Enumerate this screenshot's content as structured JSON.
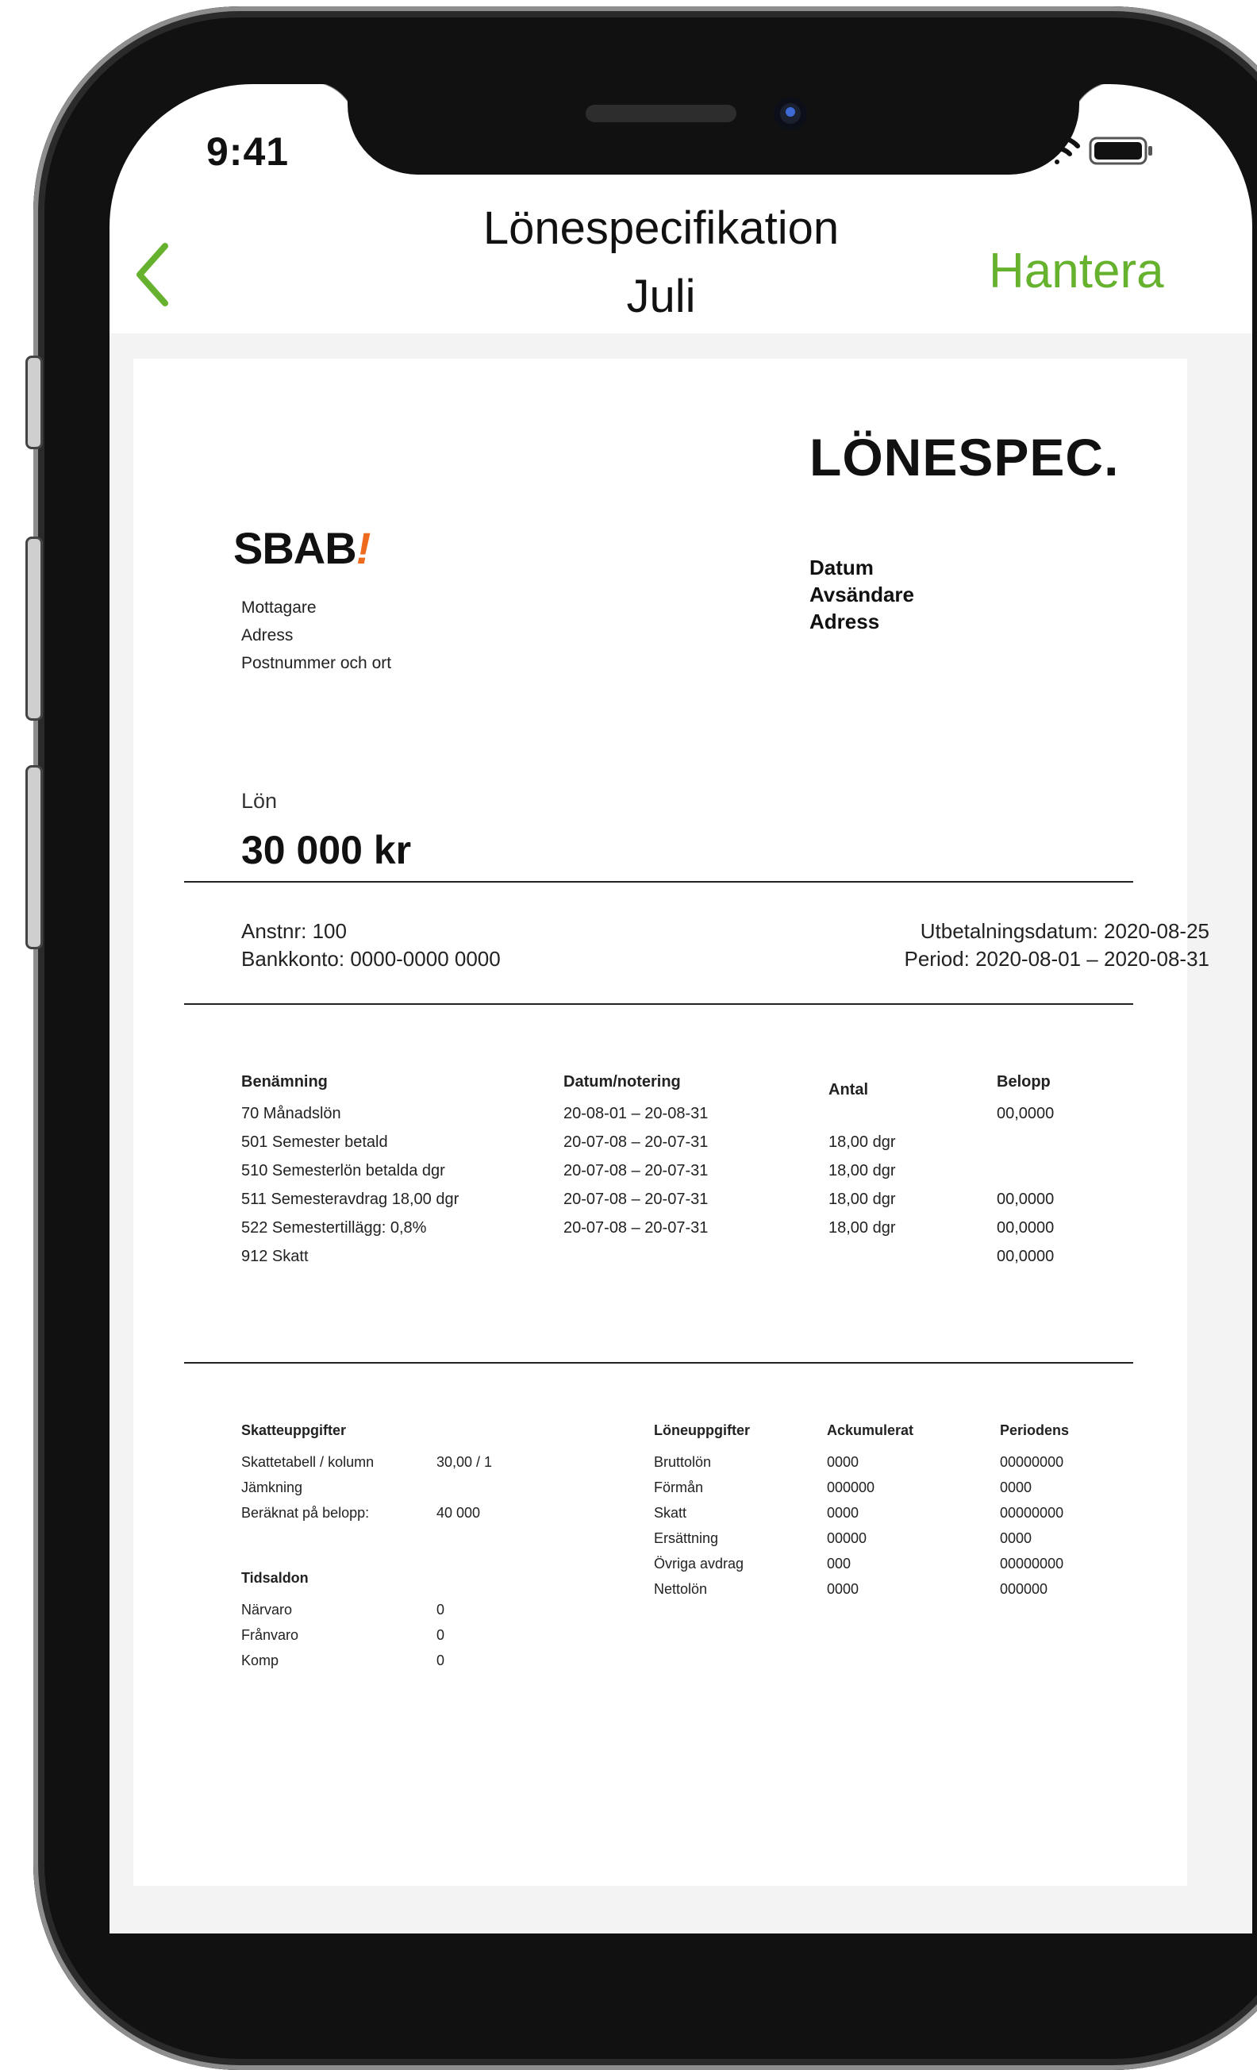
{
  "status_bar": {
    "time": "9:41"
  },
  "nav": {
    "title_line1": "Lönespecifikation",
    "title_line2": "Juli",
    "manage_label": "Hantera"
  },
  "document": {
    "heading": "LÖNESPEC.",
    "logo_text": "SBAB",
    "logo_mark": "!",
    "recipient": [
      "Mottagare",
      "Adress",
      "Postnummer och ort"
    ],
    "sender": [
      "Datum",
      "Avsändare",
      "Adress"
    ],
    "salary_label": "Lön",
    "salary_amount": "30 000 kr",
    "employee_number": "Anstnr: 100",
    "bank_account": "Bankkonto: 0000-0000 0000",
    "payout_date": "Utbetalningsdatum: 2020-08-25",
    "period": "Period: 2020-08-01 – 2020-08-31",
    "items": {
      "headers": [
        "Benämning",
        "Datum/notering",
        "Antal",
        "Belopp"
      ],
      "rows": [
        [
          "70 Månadslön",
          "20-08-01 – 20-08-31",
          "",
          "00,0000"
        ],
        [
          "501 Semester betald",
          "20-07-08 – 20-07-31",
          "18,00 dgr",
          ""
        ],
        [
          "510 Semesterlön betalda dgr",
          "20-07-08 – 20-07-31",
          "18,00 dgr",
          ""
        ],
        [
          "511 Semesteravdrag 18,00 dgr",
          "20-07-08 – 20-07-31",
          "18,00 dgr",
          "00,0000"
        ],
        [
          "522 Semestertillägg: 0,8%",
          "20-07-08 – 20-07-31",
          "18,00 dgr",
          "00,0000"
        ],
        [
          "912 Skatt",
          "",
          "",
          "00,0000"
        ]
      ]
    },
    "tax": {
      "title": "Skatteuppgifter",
      "rows": [
        [
          "Skattetabell / kolumn",
          "30,00 / 1"
        ],
        [
          "Jämkning",
          ""
        ],
        [
          "Beräknat på belopp:",
          "40 000"
        ]
      ]
    },
    "time_balance": {
      "title": "Tidsaldon",
      "rows": [
        [
          "Närvaro",
          "0"
        ],
        [
          "Frånvaro",
          "0"
        ],
        [
          "Komp",
          "0"
        ]
      ]
    },
    "salary_info": {
      "headers": [
        "Löneuppgifter",
        "Ackumulerat",
        "Periodens"
      ],
      "rows": [
        [
          "Bruttolön",
          "0000",
          "00000000"
        ],
        [
          "Förmån",
          "000000",
          "0000"
        ],
        [
          "Skatt",
          "0000",
          "00000000"
        ],
        [
          "Ersättning",
          "00000",
          "0000"
        ],
        [
          "Övriga avdrag",
          "000",
          "00000000"
        ],
        [
          "Nettolön",
          "0000",
          "000000"
        ]
      ]
    }
  },
  "colors": {
    "accent_green": "#66b22e",
    "logo_orange": "#ee6a1f"
  }
}
